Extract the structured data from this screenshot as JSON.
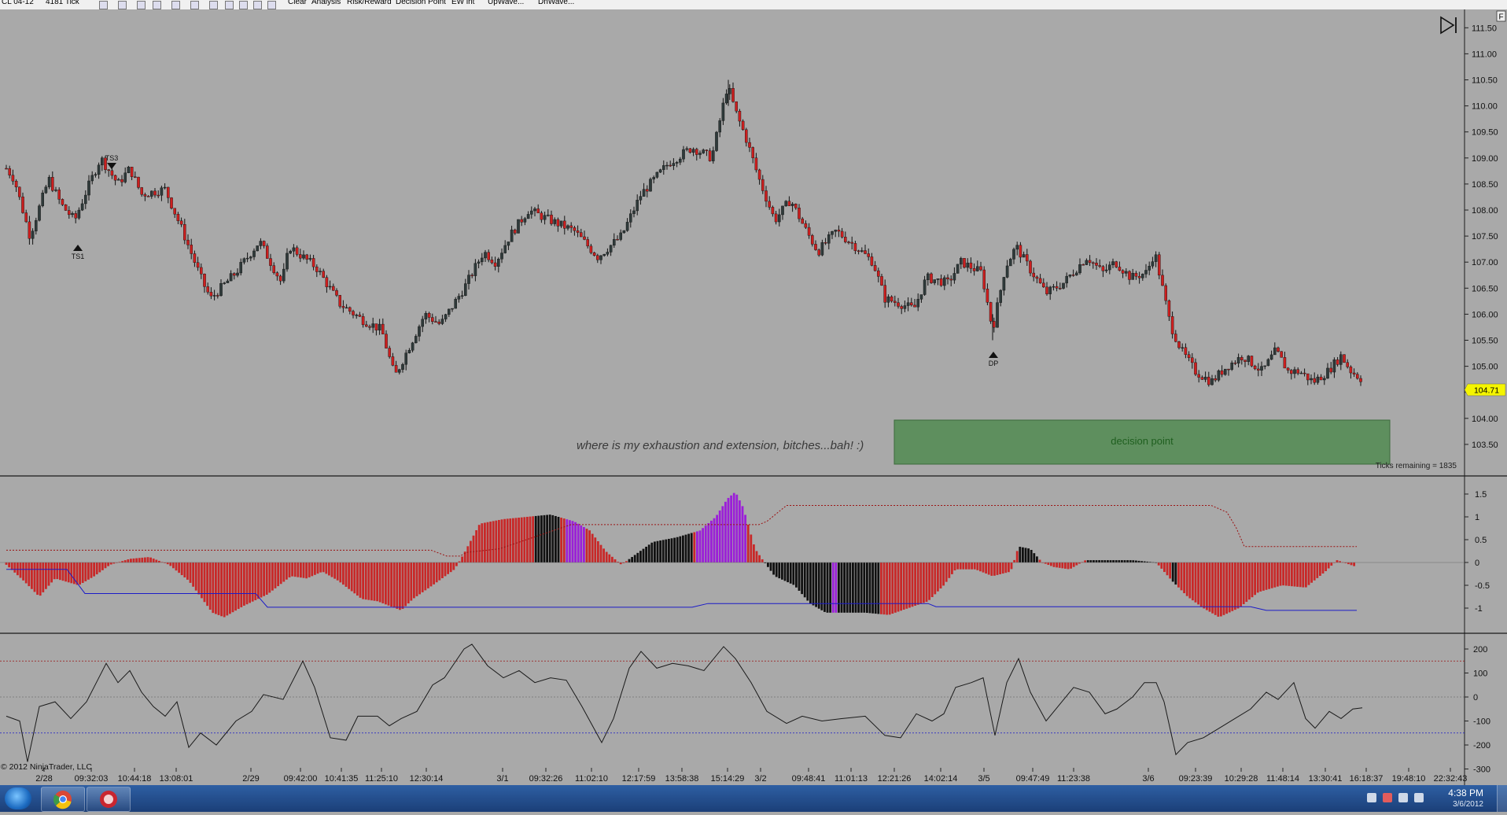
{
  "toolbar": {
    "instrument": "CL 04-12",
    "period": "4181 Tick",
    "menu_clear": "Clear",
    "menu_analysis": "Analysis",
    "menu_risk": "Risk/Reward",
    "menu_decision": "Decision Point",
    "menu_ewint": "EW int",
    "menu_upwave": "UpWave...",
    "menu_dnwave": "DnWave..."
  },
  "chart": {
    "price_labels": [
      "111.50",
      "111.00",
      "110.50",
      "110.00",
      "109.50",
      "109.00",
      "108.50",
      "108.00",
      "107.50",
      "107.00",
      "106.50",
      "106.00",
      "105.50",
      "105.00",
      "104.50",
      "104.00",
      "103.50"
    ],
    "last_price": "104.71",
    "annotation": "where is my exhaustion and extension, bitches...bah!  :)",
    "decision_box_label": "decision point",
    "ticks_remaining": "Ticks remaining = 1835",
    "markers": [
      {
        "label": "TS3",
        "price": 109.0
      },
      {
        "label": "TS1",
        "price": 107.6
      },
      {
        "label": "DP",
        "price": 105.3
      }
    ],
    "osc_labels": [
      "1.5",
      "1",
      "0.5",
      "0",
      "-0.5",
      "-1"
    ],
    "cci_labels": [
      "200",
      "100",
      "0",
      "-100",
      "-200",
      "-300"
    ],
    "copyright": "© 2012 NinjaTrader, LLC",
    "time_labels": [
      "2/28",
      "09:32:03",
      "10:44:18",
      "13:08:01",
      "2/29",
      "09:42:00",
      "10:41:35",
      "11:25:10",
      "12:30:14",
      "3/1",
      "09:32:26",
      "11:02:10",
      "12:17:59",
      "13:58:38",
      "15:14:29",
      "3/2",
      "09:48:41",
      "11:01:13",
      "12:21:26",
      "14:02:14",
      "3/5",
      "09:47:49",
      "11:23:38",
      "3/6",
      "09:23:39",
      "10:29:28",
      "11:48:14",
      "13:30:41",
      "16:18:37",
      "19:48:10",
      "22:32:43"
    ],
    "panel_button": "F",
    "colors": {
      "background": "#a9a9a9",
      "up_bar": "#2f3a3a",
      "down_bar": "#cc1f1f",
      "hist_red": "#c82828",
      "hist_purple": "#9b1fd8",
      "hist_black": "#111111",
      "decision_fill": "#5e8f5e",
      "last_price_bg": "#f5f500"
    }
  },
  "taskbar": {
    "time": "4:38 PM",
    "date": "3/6/2012"
  }
}
